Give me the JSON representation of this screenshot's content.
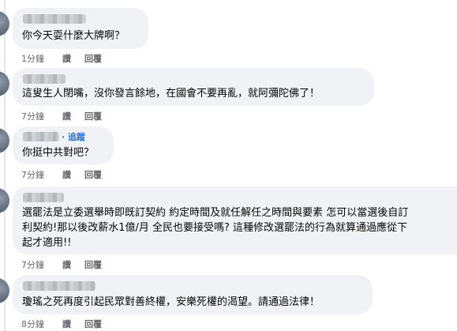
{
  "comments": [
    {
      "text": "你今天耍什麼大牌啊？",
      "time": "1分鐘",
      "like": "讚",
      "reply": "回覆"
    },
    {
      "text": "這叟生人閉嘴，沒你發言餘地，在國會不要再亂，就阿彌陀佛了！",
      "time": "7分鐘",
      "like": "讚",
      "reply": "回覆"
    },
    {
      "follow": "追蹤",
      "text": "你挺中共對吧？",
      "time": "7分鐘",
      "like": "讚",
      "reply": "回覆"
    },
    {
      "lines": [
        "選罷法是立委選舉時即既訂契約 約定時間及就任解任之時間與要素 怎可以當選後自訂",
        "利契約!那以後改薪水1億/月 全民也要接受嗎? 這種修改選罷法的行為就算通過應從下",
        "起才適用!!"
      ],
      "time": "7分鐘",
      "like": "讚",
      "reply": "回覆"
    },
    {
      "text": "瓊瑤之死再度引起民眾對善終權，安樂死權的渴望。請通過法律！",
      "time": "8分鐘",
      "like": "讚",
      "reply": "回覆"
    }
  ]
}
